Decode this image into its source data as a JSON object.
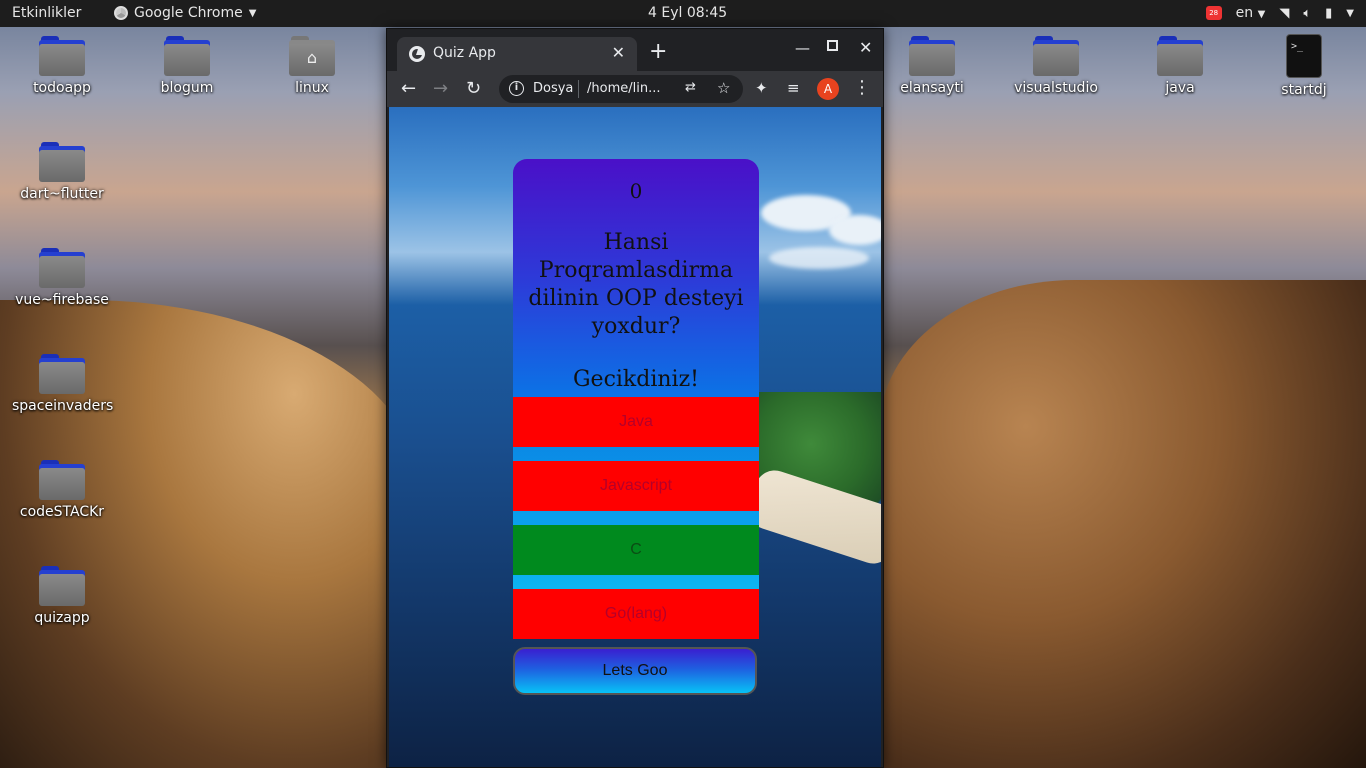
{
  "top_panel": {
    "activities": "Etkinlikler",
    "app_name": "Google Chrome",
    "clock": "4 Eyl  08:45",
    "notification_count": "28",
    "language": "en"
  },
  "desktop_icons": [
    {
      "label": "todoapp",
      "icon": "folder-icon"
    },
    {
      "label": "blogum",
      "icon": "folder-icon"
    },
    {
      "label": "linux",
      "icon": "home-folder-icon"
    },
    {
      "label": "dart~flutter",
      "icon": "folder-icon"
    },
    {
      "label": "vue~firebase",
      "icon": "folder-icon"
    },
    {
      "label": "spaceinvaders",
      "icon": "folder-icon"
    },
    {
      "label": "codeSTACKr",
      "icon": "folder-icon"
    },
    {
      "label": "quizapp",
      "icon": "folder-icon"
    },
    {
      "label": "elansayti",
      "icon": "folder-icon"
    },
    {
      "label": "visualstudio",
      "icon": "folder-icon"
    },
    {
      "label": "java",
      "icon": "folder-icon"
    },
    {
      "label": "startdj",
      "icon": "terminal-icon"
    }
  ],
  "browser": {
    "tab_title": "Quiz App",
    "new_tab": "+",
    "omnibox_scheme": "Dosya",
    "omnibox_url": "/home/lin...",
    "avatar_letter": "A"
  },
  "quiz": {
    "score": "0",
    "question": "Hansi Proqramlasdirma dilinin OOP desteyi yoxdur?",
    "status": "Gecikdiniz!",
    "answers": [
      {
        "label": "Java",
        "state": "wrong",
        "color": "#ff0000"
      },
      {
        "label": "Javascript",
        "state": "wrong",
        "color": "#ff0000"
      },
      {
        "label": "C",
        "state": "correct",
        "color": "#008a1e"
      },
      {
        "label": "Go(lang)",
        "state": "wrong",
        "color": "#ff0000"
      }
    ],
    "next_button": "Lets Goo"
  }
}
